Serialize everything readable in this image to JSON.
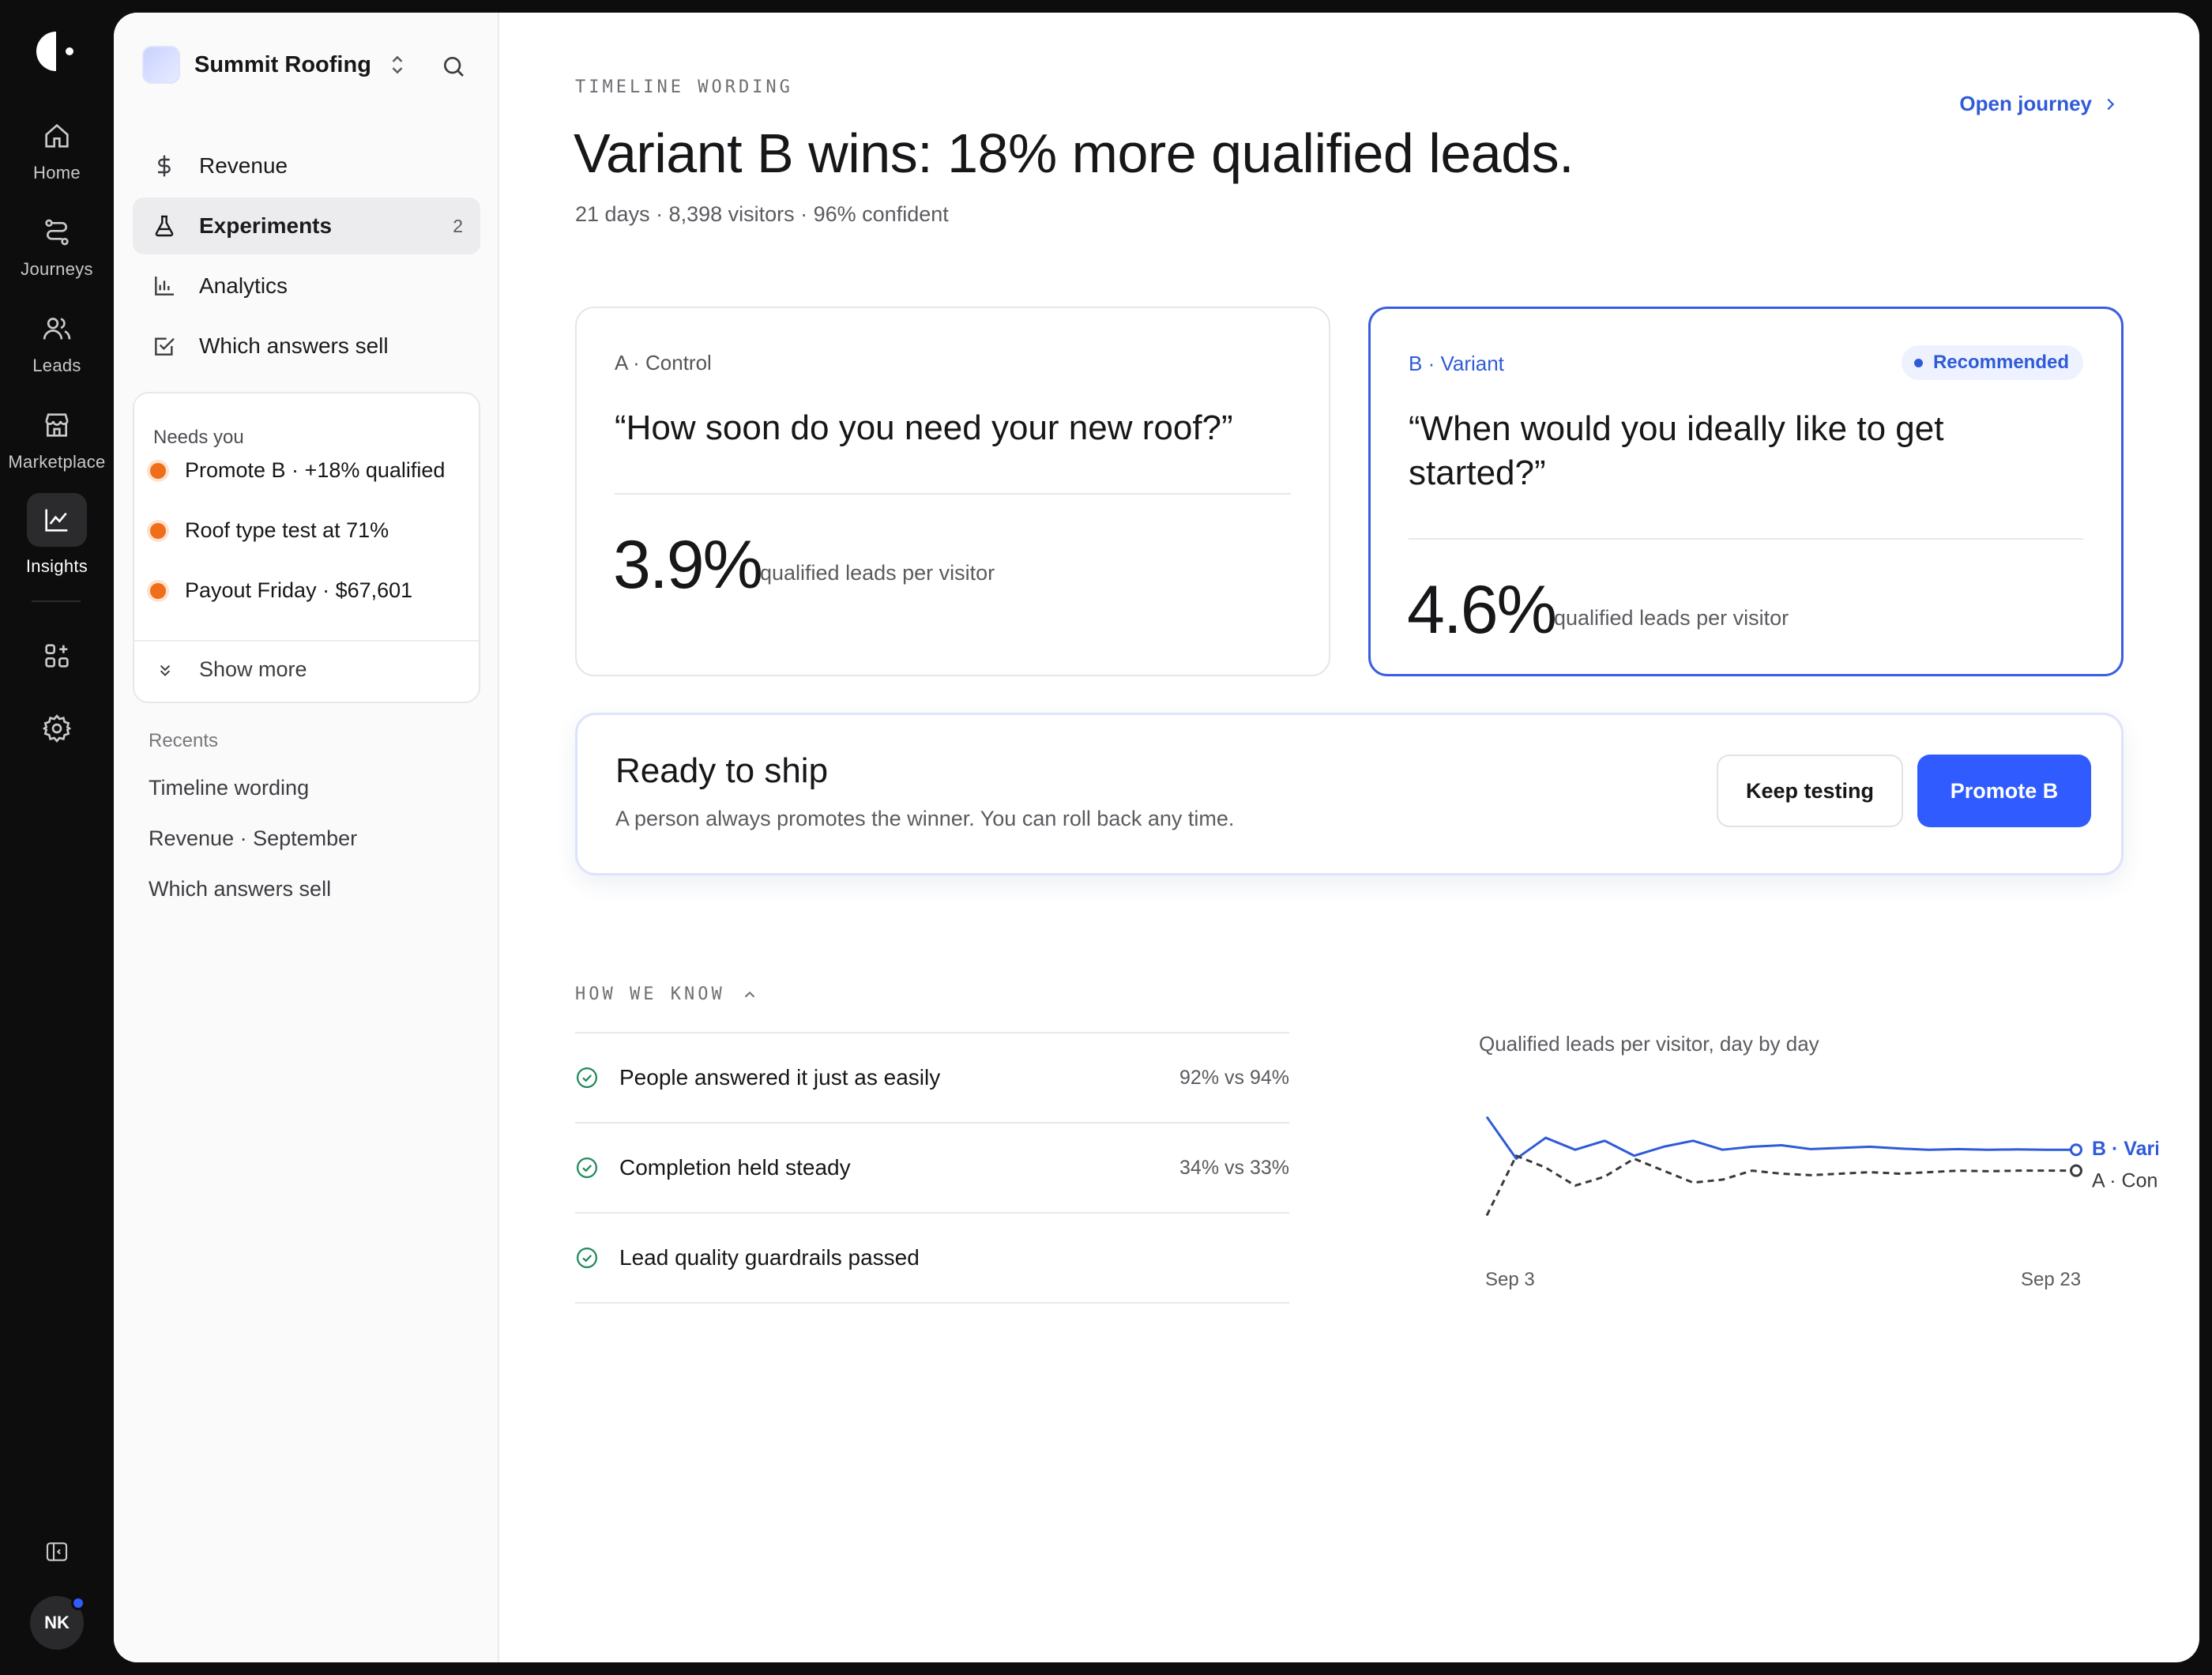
{
  "rail": {
    "items": [
      {
        "label": "Home",
        "icon": "home-icon"
      },
      {
        "label": "Journeys",
        "icon": "route-icon"
      },
      {
        "label": "Leads",
        "icon": "users-icon"
      },
      {
        "label": "Marketplace",
        "icon": "store-icon"
      },
      {
        "label": "Insights",
        "icon": "chart-icon",
        "active": true
      }
    ],
    "avatar_initials": "NK"
  },
  "workspace": {
    "name": "Summit Roofing"
  },
  "nav": {
    "items": [
      {
        "label": "Revenue",
        "icon": "dollar-icon"
      },
      {
        "label": "Experiments",
        "icon": "flask-icon",
        "count": "2",
        "active": true
      },
      {
        "label": "Analytics",
        "icon": "bar-chart-icon"
      },
      {
        "label": "Which answers sell",
        "icon": "checkbox-icon"
      }
    ]
  },
  "needs_you": {
    "title": "Needs you",
    "items": [
      "Promote B · +18% qualified",
      "Roof type test at 71%",
      "Payout Friday · $67,601"
    ],
    "show_more": "Show more"
  },
  "recents": {
    "title": "Recents",
    "items": [
      "Timeline wording",
      "Revenue · September",
      "Which answers sell"
    ]
  },
  "page": {
    "eyebrow": "TIMELINE WORDING",
    "headline": "Variant B wins: 18% more qualified leads.",
    "subline": "21 days · 8,398 visitors · 96% confident",
    "open_journey": "Open journey"
  },
  "variants": {
    "a": {
      "label": "A · Control",
      "quote": "“How soon do you need your new roof?”",
      "value": "3.9%",
      "unit": "qualified leads per visitor"
    },
    "b": {
      "label": "B · Variant",
      "quote": "“When would you ideally like to get started?”",
      "value": "4.6%",
      "unit": "qualified leads per visitor",
      "badge": "Recommended"
    }
  },
  "ship": {
    "title": "Ready to ship",
    "subtitle": "A person always promotes the winner. You can roll back any time.",
    "keep_label": "Keep testing",
    "promote_label": "Promote B"
  },
  "how_we_know": {
    "title": "HOW WE KNOW",
    "checks": [
      {
        "label": "People answered it just as easily",
        "value": "92% vs 94%"
      },
      {
        "label": "Completion held steady",
        "value": "34% vs 33%"
      },
      {
        "label": "Lead quality guardrails passed",
        "value": ""
      }
    ]
  },
  "colors": {
    "accent": "#2f5bff",
    "variant_line": "#2f5bd8",
    "control_line": "#3a3a3e",
    "alert_dot": "#f06d1a"
  },
  "chart_data": {
    "type": "line",
    "title": "Qualified leads per visitor, day by day",
    "x_ticks": [
      "Sep 3",
      "Sep 23"
    ],
    "x": [
      "Sep 3",
      "Sep 4",
      "Sep 5",
      "Sep 6",
      "Sep 7",
      "Sep 8",
      "Sep 9",
      "Sep 10",
      "Sep 11",
      "Sep 12",
      "Sep 13",
      "Sep 14",
      "Sep 15",
      "Sep 16",
      "Sep 17",
      "Sep 18",
      "Sep 19",
      "Sep 20",
      "Sep 21",
      "Sep 22",
      "Sep 23"
    ],
    "series": [
      {
        "name": "B · Variant",
        "values": [
          5.7,
          4.3,
          5.0,
          4.6,
          4.9,
          4.4,
          4.7,
          4.9,
          4.6,
          4.7,
          4.75,
          4.62,
          4.66,
          4.7,
          4.64,
          4.6,
          4.62,
          4.6,
          4.61,
          4.6,
          4.6
        ]
      },
      {
        "name": "A · Control",
        "values": [
          2.4,
          4.4,
          4.0,
          3.4,
          3.7,
          4.3,
          3.9,
          3.5,
          3.6,
          3.9,
          3.8,
          3.75,
          3.8,
          3.85,
          3.8,
          3.85,
          3.9,
          3.88,
          3.9,
          3.9,
          3.9
        ]
      }
    ],
    "legend": "right of lines",
    "grid": false
  }
}
